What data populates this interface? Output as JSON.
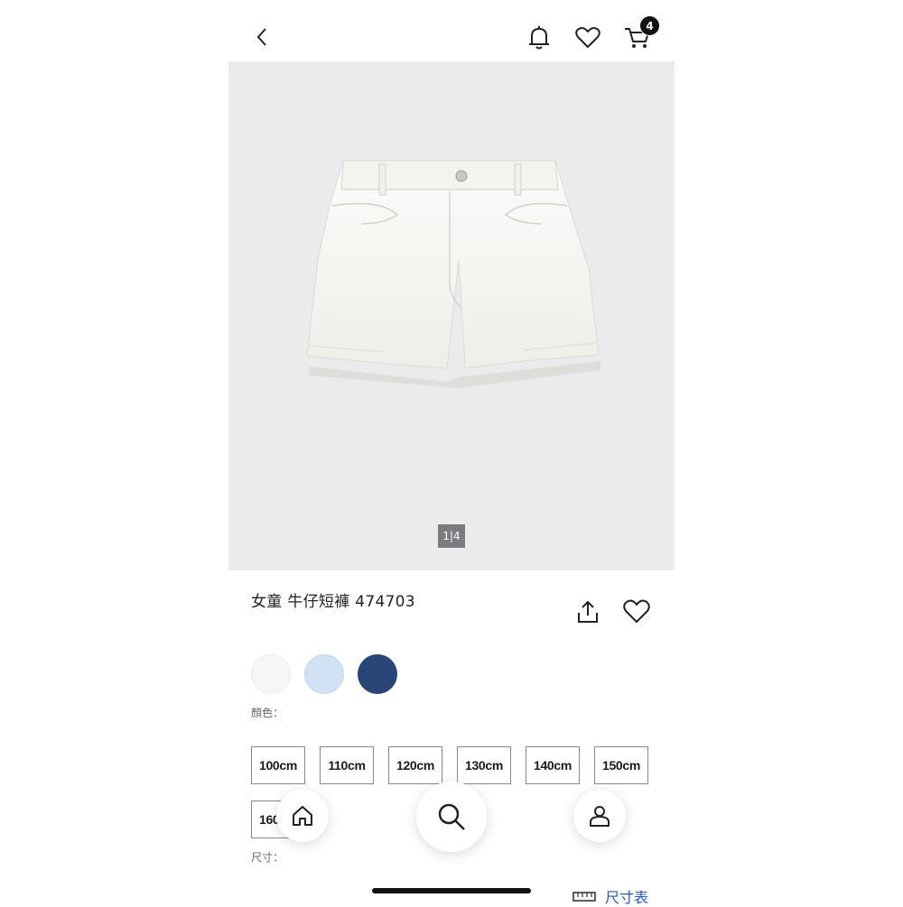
{
  "header": {
    "back_icon": "chevron-left-icon",
    "notification_icon": "bell-icon",
    "favorite_icon": "heart-icon",
    "cart_icon": "cart-icon",
    "cart_count": "4"
  },
  "product": {
    "image_pager": "1|4",
    "title": "女童 牛仔短褲 474703",
    "share_icon": "share-icon",
    "favorite_icon": "heart-icon"
  },
  "colors": {
    "label": "顏色：",
    "swatches": [
      {
        "color": "#f6f6f6"
      },
      {
        "color": "#d2e2f5"
      },
      {
        "color": "#2a4678"
      }
    ]
  },
  "sizes": {
    "label": "尺寸：",
    "options": [
      "100cm",
      "110cm",
      "120cm",
      "130cm",
      "140cm",
      "150cm",
      "160cm"
    ]
  },
  "size_chart": {
    "icon": "ruler-icon",
    "label": "尺寸表"
  },
  "bottom_nav": {
    "home_icon": "home-icon",
    "search_icon": "search-icon",
    "account_icon": "user-icon"
  }
}
